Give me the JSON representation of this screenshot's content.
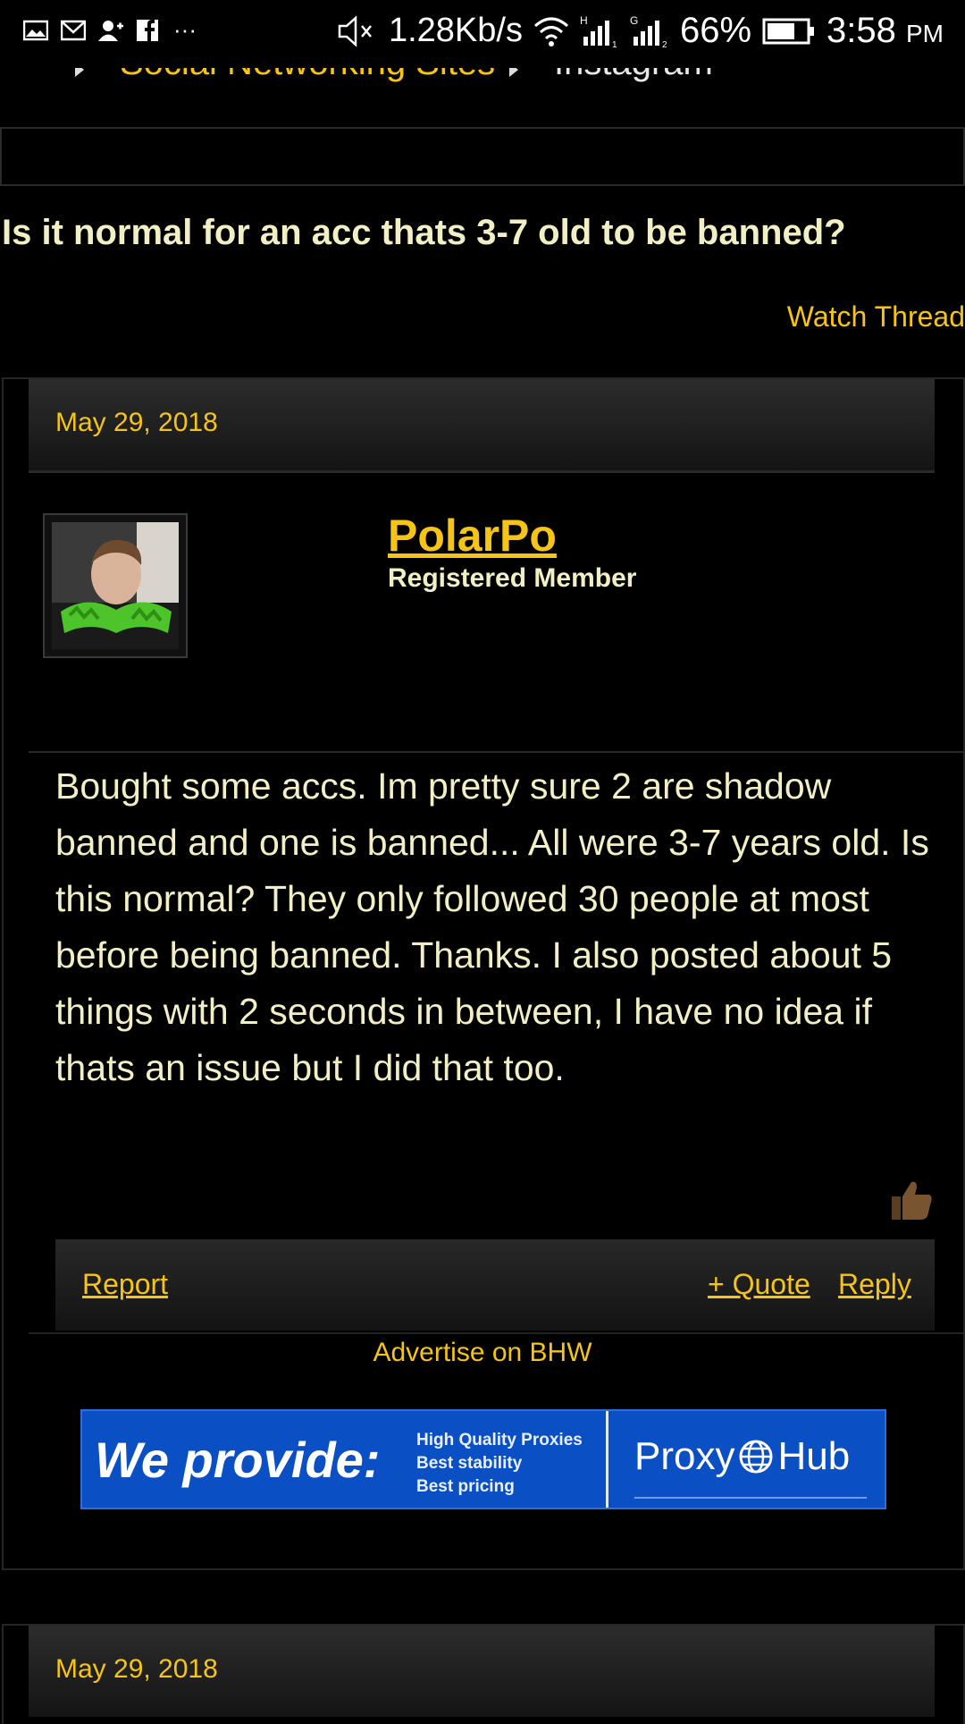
{
  "status_bar": {
    "speed": "1.28Kb/s",
    "network1": "H",
    "network2": "G",
    "battery": "66%",
    "time": "3:58",
    "ampm": "PM",
    "more": "···"
  },
  "breadcrumb": {
    "items": [
      "Social Networking Sites",
      "Instagram"
    ]
  },
  "thread": {
    "title": "Is it normal for an acc thats 3-7 old to be banned?",
    "watch_label": "Watch Thread"
  },
  "post": {
    "date": "May 29, 2018",
    "username": "PolarPo",
    "role": "Registered Member",
    "body": "Bought some accs. Im pretty sure 2 are shadow banned and one is banned... All were 3-7 years old. Is this normal? They only followed 30 people at most before being banned. Thanks. I also posted about 5 things with 2 seconds in between, I have no idea if thats an issue but I did that too.",
    "actions": {
      "report": "Report",
      "quote": "+ Quote",
      "reply": "Reply"
    }
  },
  "ad": {
    "label": "Advertise on BHW",
    "banner": {
      "headline": "We provide:",
      "features": [
        "High Quality Proxies",
        "Best stability",
        "Best pricing"
      ],
      "brand_left": "Proxy",
      "brand_right": "Hub"
    }
  },
  "next_post": {
    "date": "May 29, 2018"
  },
  "colors": {
    "accent": "#f6c417",
    "text": "#f3efc4",
    "background": "#000000",
    "banner": "#0a4fc4"
  }
}
